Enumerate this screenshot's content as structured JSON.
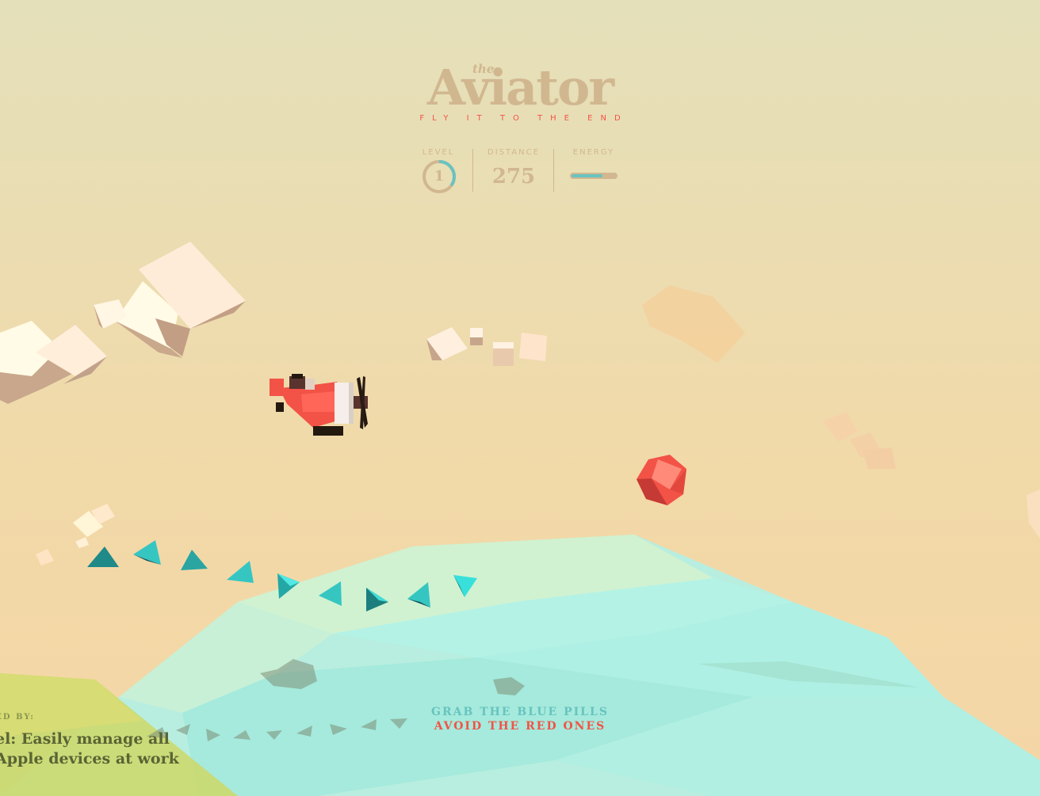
{
  "header": {
    "title_small": "the",
    "title": "Aviator",
    "subtitle": "FLY IT TO THE END"
  },
  "stats": {
    "level_label": "LEVEL",
    "level_value": "1",
    "level_progress": 0.35,
    "distance_label": "DISTANCE",
    "distance_value": "275",
    "energy_label": "ENERGY",
    "energy_fraction": 0.7
  },
  "instructions": {
    "line1": "GRAB THE BLUE PILLS",
    "line2": "AVOID THE RED ONES"
  },
  "sponsor": {
    "label": "RED BY:",
    "line1": "el: Easily manage all",
    "line2": "Apple devices at work"
  },
  "colors": {
    "plane_red": "#f25346",
    "pill_blue": "#36c6c2",
    "sea": "#a8ecdf",
    "title": "#d1b790"
  }
}
